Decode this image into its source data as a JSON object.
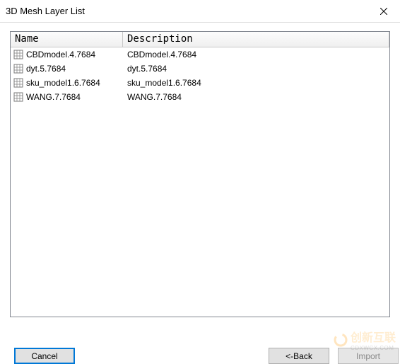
{
  "window": {
    "title": "3D Mesh Layer List"
  },
  "table": {
    "columns": {
      "name": "Name",
      "description": "Description"
    },
    "rows": [
      {
        "name": "CBDmodel.4.7684",
        "description": "CBDmodel.4.7684"
      },
      {
        "name": "dyt.5.7684",
        "description": "dyt.5.7684"
      },
      {
        "name": "sku_model1.6.7684",
        "description": "sku_model1.6.7684"
      },
      {
        "name": "WANG.7.7684",
        "description": "WANG.7.7684"
      }
    ]
  },
  "buttons": {
    "cancel": "Cancel",
    "back": "<-Back",
    "import": "Import"
  },
  "watermark": {
    "text": "创新互联",
    "sub": "CDXWCX.COM"
  }
}
